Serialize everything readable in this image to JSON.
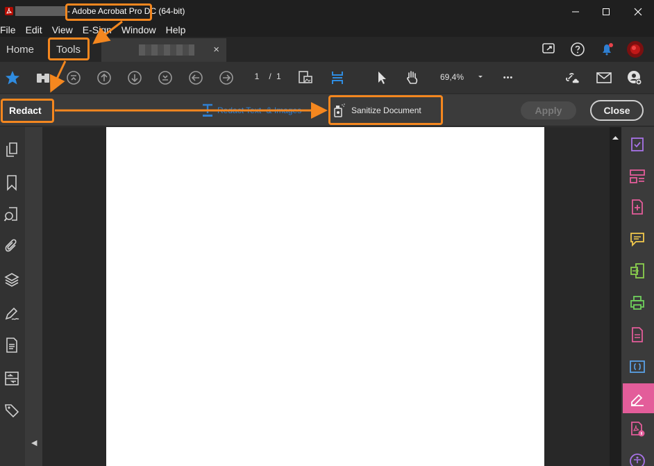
{
  "window": {
    "title": "- Adobe Acrobat Pro DC (64-bit)",
    "controls": [
      "minimize-icon",
      "maximize-icon",
      "close-icon"
    ]
  },
  "menu": {
    "items": [
      "File",
      "Edit",
      "View",
      "E-Sign",
      "Window",
      "Help"
    ]
  },
  "tabs": {
    "home": "Home",
    "tools": "Tools",
    "doc_close": "×"
  },
  "toolbar": {
    "page_current": "1",
    "page_sep": "/",
    "page_total": "1",
    "zoom": "69,4%",
    "more": "•••"
  },
  "redact": {
    "label": "Redact",
    "redact_text": "Redact Text",
    "redact_text_suffix": "& Images",
    "sanitize_label": "Sanitize Document",
    "apply_label": "Apply",
    "close_label": "Close"
  },
  "left_rail": {
    "icons": [
      "pages-icon",
      "bookmark-icon",
      "search-document-icon",
      "attachment-icon",
      "layers-icon",
      "signature-icon",
      "document-icon",
      "compare-icon",
      "tag-icon"
    ],
    "collapse": "◀"
  },
  "right_rail": {
    "icons": [
      "fill-sign-icon",
      "organize-pages-icon",
      "create-pdf-icon",
      "comment-icon",
      "export-pdf-icon",
      "print-production-icon",
      "edit-pdf-icon",
      "javascript-icon",
      "redact-icon",
      "pdf-properties-icon",
      "accessibility-icon"
    ]
  },
  "colors": {
    "accent_blue": "#2f7fd1",
    "annotation_orange": "#f4871f",
    "active_tool_pink": "#e35d9a"
  }
}
